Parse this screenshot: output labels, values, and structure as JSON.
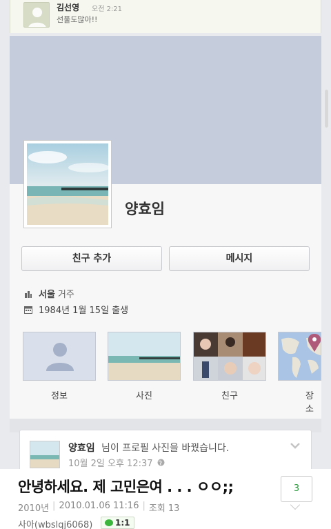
{
  "top_comment": {
    "author": "김선영",
    "time": "오전 2:21",
    "text": "선풀도많아!!"
  },
  "profile": {
    "name": "양효임",
    "add_friend_label": "친구 추가",
    "message_label": "메시지",
    "city": "서울",
    "city_suffix": "거주",
    "birth": "1984년 1월 15일 출생"
  },
  "tiles": {
    "info": "정보",
    "photos": "사진",
    "friends": "친구",
    "places": "장소"
  },
  "story": {
    "name": "양효임",
    "text": "님이 프로필 사진을 바꿨습니다.",
    "time": "10월 2일 오후 12:37"
  },
  "post": {
    "title": "안녕하세요. 제 고민은여 . . . ㅇㅇ;;",
    "year": "2010년",
    "datetime": "2010.01.06 11:16",
    "views": "조회 13",
    "author": "사아(wbslqj6068)",
    "chat_badge": "1:1",
    "comment_count": "3"
  },
  "colors": {
    "cover": "#c5cddd",
    "accent_green": "#2a9d3c"
  }
}
